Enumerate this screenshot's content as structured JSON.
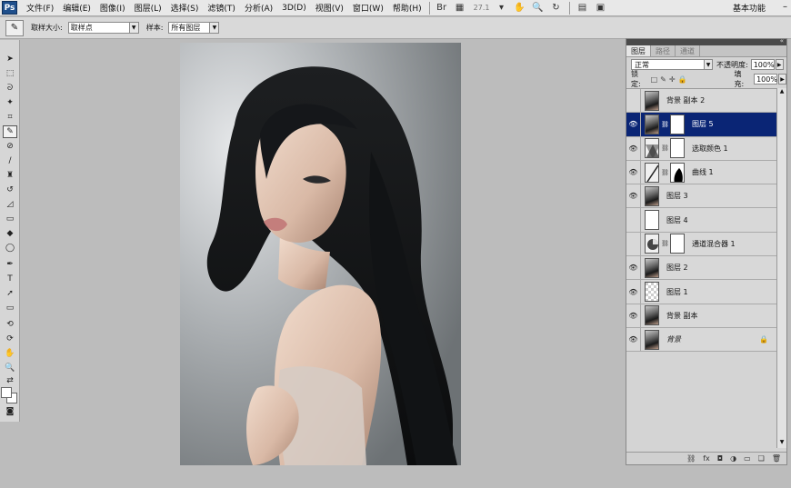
{
  "menubar": {
    "logo": "Ps",
    "items": [
      "文件(F)",
      "编辑(E)",
      "图像(I)",
      "图层(L)",
      "选择(S)",
      "滤镜(T)",
      "分析(A)",
      "3D(D)",
      "视图(V)",
      "窗口(W)",
      "帮助(H)"
    ],
    "zoom": "27.1",
    "workspace": "基本功能"
  },
  "options": {
    "sample_size_label": "取样大小:",
    "sample_size_value": "取样点",
    "sample_label": "样本:",
    "sample_value": "所有图层"
  },
  "layers_panel": {
    "tabs": [
      "图层",
      "路径",
      "通道"
    ],
    "blend_mode": "正常",
    "opacity_label": "不透明度:",
    "opacity": "100%",
    "lock_label": "锁定:",
    "fill_label": "填充:",
    "fill": "100%",
    "layers": [
      {
        "name": "背景 副本 2",
        "visible": false,
        "thumb": "photo",
        "selected": false,
        "locked": false
      },
      {
        "name": "图层 5",
        "visible": true,
        "thumb": "photo",
        "mask": "mask",
        "selected": true,
        "locked": false
      },
      {
        "name": "选取颜色 1",
        "visible": true,
        "thumb": "adjust",
        "mask": "mask",
        "selected": false,
        "locked": false
      },
      {
        "name": "曲线 1",
        "visible": true,
        "thumb": "adjust",
        "mask": "mask-shape",
        "selected": false,
        "locked": false
      },
      {
        "name": "图层 3",
        "visible": true,
        "thumb": "photo",
        "selected": false,
        "locked": false
      },
      {
        "name": "图层 4",
        "visible": false,
        "thumb": "mask",
        "selected": false,
        "locked": false
      },
      {
        "name": "通道混合器 1",
        "visible": false,
        "thumb": "adjust",
        "mask": "mask",
        "selected": false,
        "locked": false
      },
      {
        "name": "图层 2",
        "visible": true,
        "thumb": "photo",
        "selected": false,
        "locked": false
      },
      {
        "name": "图层 1",
        "visible": true,
        "thumb": "checker",
        "selected": false,
        "locked": false
      },
      {
        "name": "背景 副本",
        "visible": true,
        "thumb": "photo",
        "selected": false,
        "locked": false
      },
      {
        "name": "背景",
        "visible": true,
        "thumb": "photo",
        "selected": false,
        "locked": true
      }
    ]
  },
  "icons": {
    "eye": "eye-icon",
    "lock": "lock-icon",
    "chain": "chain-icon",
    "hand": "hand-icon",
    "zoom": "zoom-icon"
  }
}
